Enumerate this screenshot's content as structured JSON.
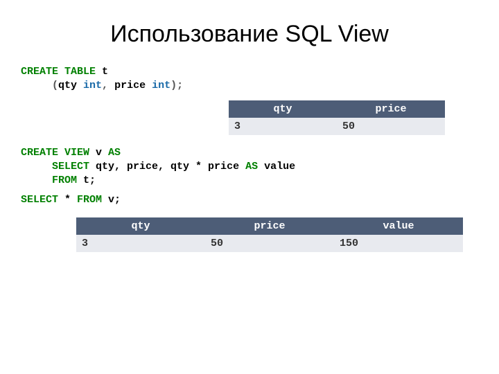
{
  "title": "Использование SQL View",
  "sql": {
    "line1a": "CREATE TABLE",
    "line1b": " t",
    "line2a": "     (",
    "line2b": "qty",
    "line2c": " int",
    "line2d": ", ",
    "line2e": "price",
    "line2f": " int",
    "line2g": ");",
    "line3a": "CREATE VIEW",
    "line3b": " v ",
    "line3c": "AS",
    "line4a": "     SELECT",
    "line4b": " qty, price, qty * price ",
    "line4c": "AS",
    "line4d": " value",
    "line5a": "     FROM",
    "line5b": " t;",
    "line6a": "SELECT",
    "line6b": " * ",
    "line6c": "FROM",
    "line6d": " v;"
  },
  "table1": {
    "headers": [
      "qty",
      "price"
    ],
    "row": [
      "3",
      "50"
    ]
  },
  "table2": {
    "headers": [
      "qty",
      "price",
      "value"
    ],
    "row": [
      "3",
      "50",
      "150"
    ]
  }
}
